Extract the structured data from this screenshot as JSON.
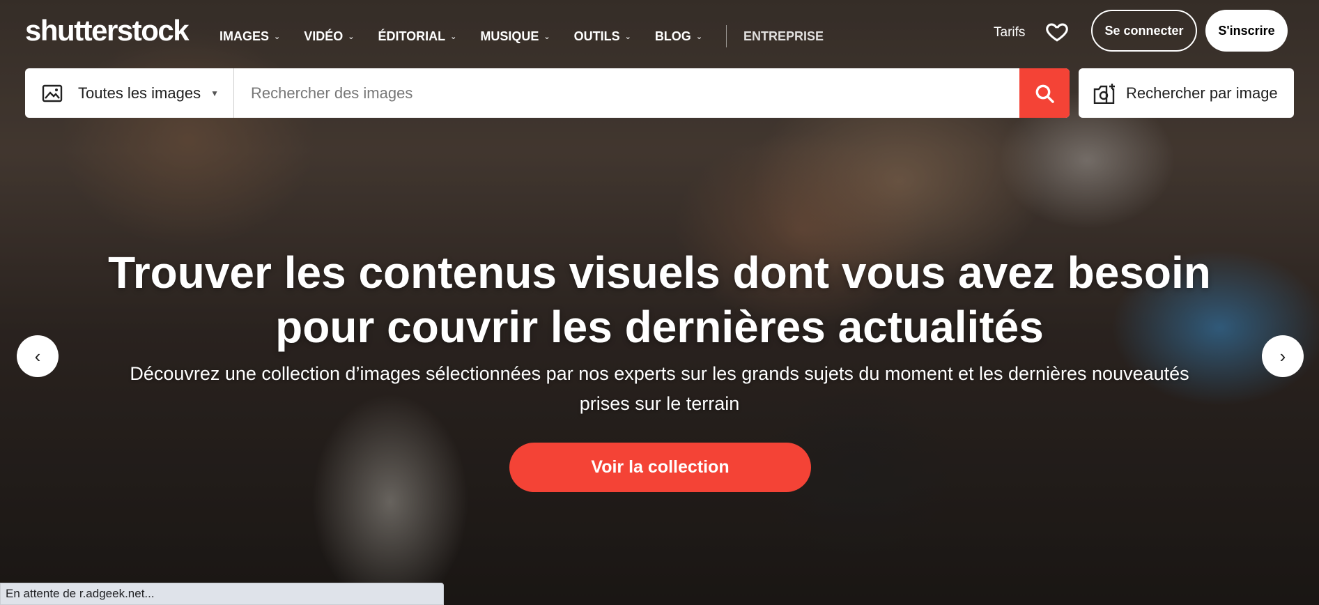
{
  "brand": {
    "logo_text": "shutterstock",
    "accent_color": "#f44336"
  },
  "nav": {
    "items": [
      {
        "label": "IMAGES"
      },
      {
        "label": "VIDÉO"
      },
      {
        "label": "ÉDITORIAL"
      },
      {
        "label": "MUSIQUE"
      },
      {
        "label": "OUTILS"
      },
      {
        "label": "BLOG"
      }
    ],
    "enterprise_label": "ENTREPRISE",
    "pricing_label": "Tarifs",
    "favorites_icon": "heart-icon",
    "login_label": "Se connecter",
    "signup_label": "S'inscrire"
  },
  "search": {
    "type_selector_label": "Toutes les images",
    "placeholder": "Rechercher des images",
    "value": "",
    "search_icon": "search-icon",
    "image_search_label": "Rechercher par image"
  },
  "hero": {
    "title_line1": "Trouver les contenus visuels dont vous avez besoin",
    "title_line2": "pour couvrir les dernières actualités",
    "subtitle_line1": "Découvrez une collection d’images sélectionnées par nos experts sur les grands sujets du moment et les dernières nouveautés",
    "subtitle_line2": "prises sur le terrain",
    "cta_label": "Voir la collection",
    "prev_icon": "chevron-left-icon",
    "next_icon": "chevron-right-icon"
  },
  "browser_status": {
    "text": "En attente de r.adgeek.net..."
  }
}
